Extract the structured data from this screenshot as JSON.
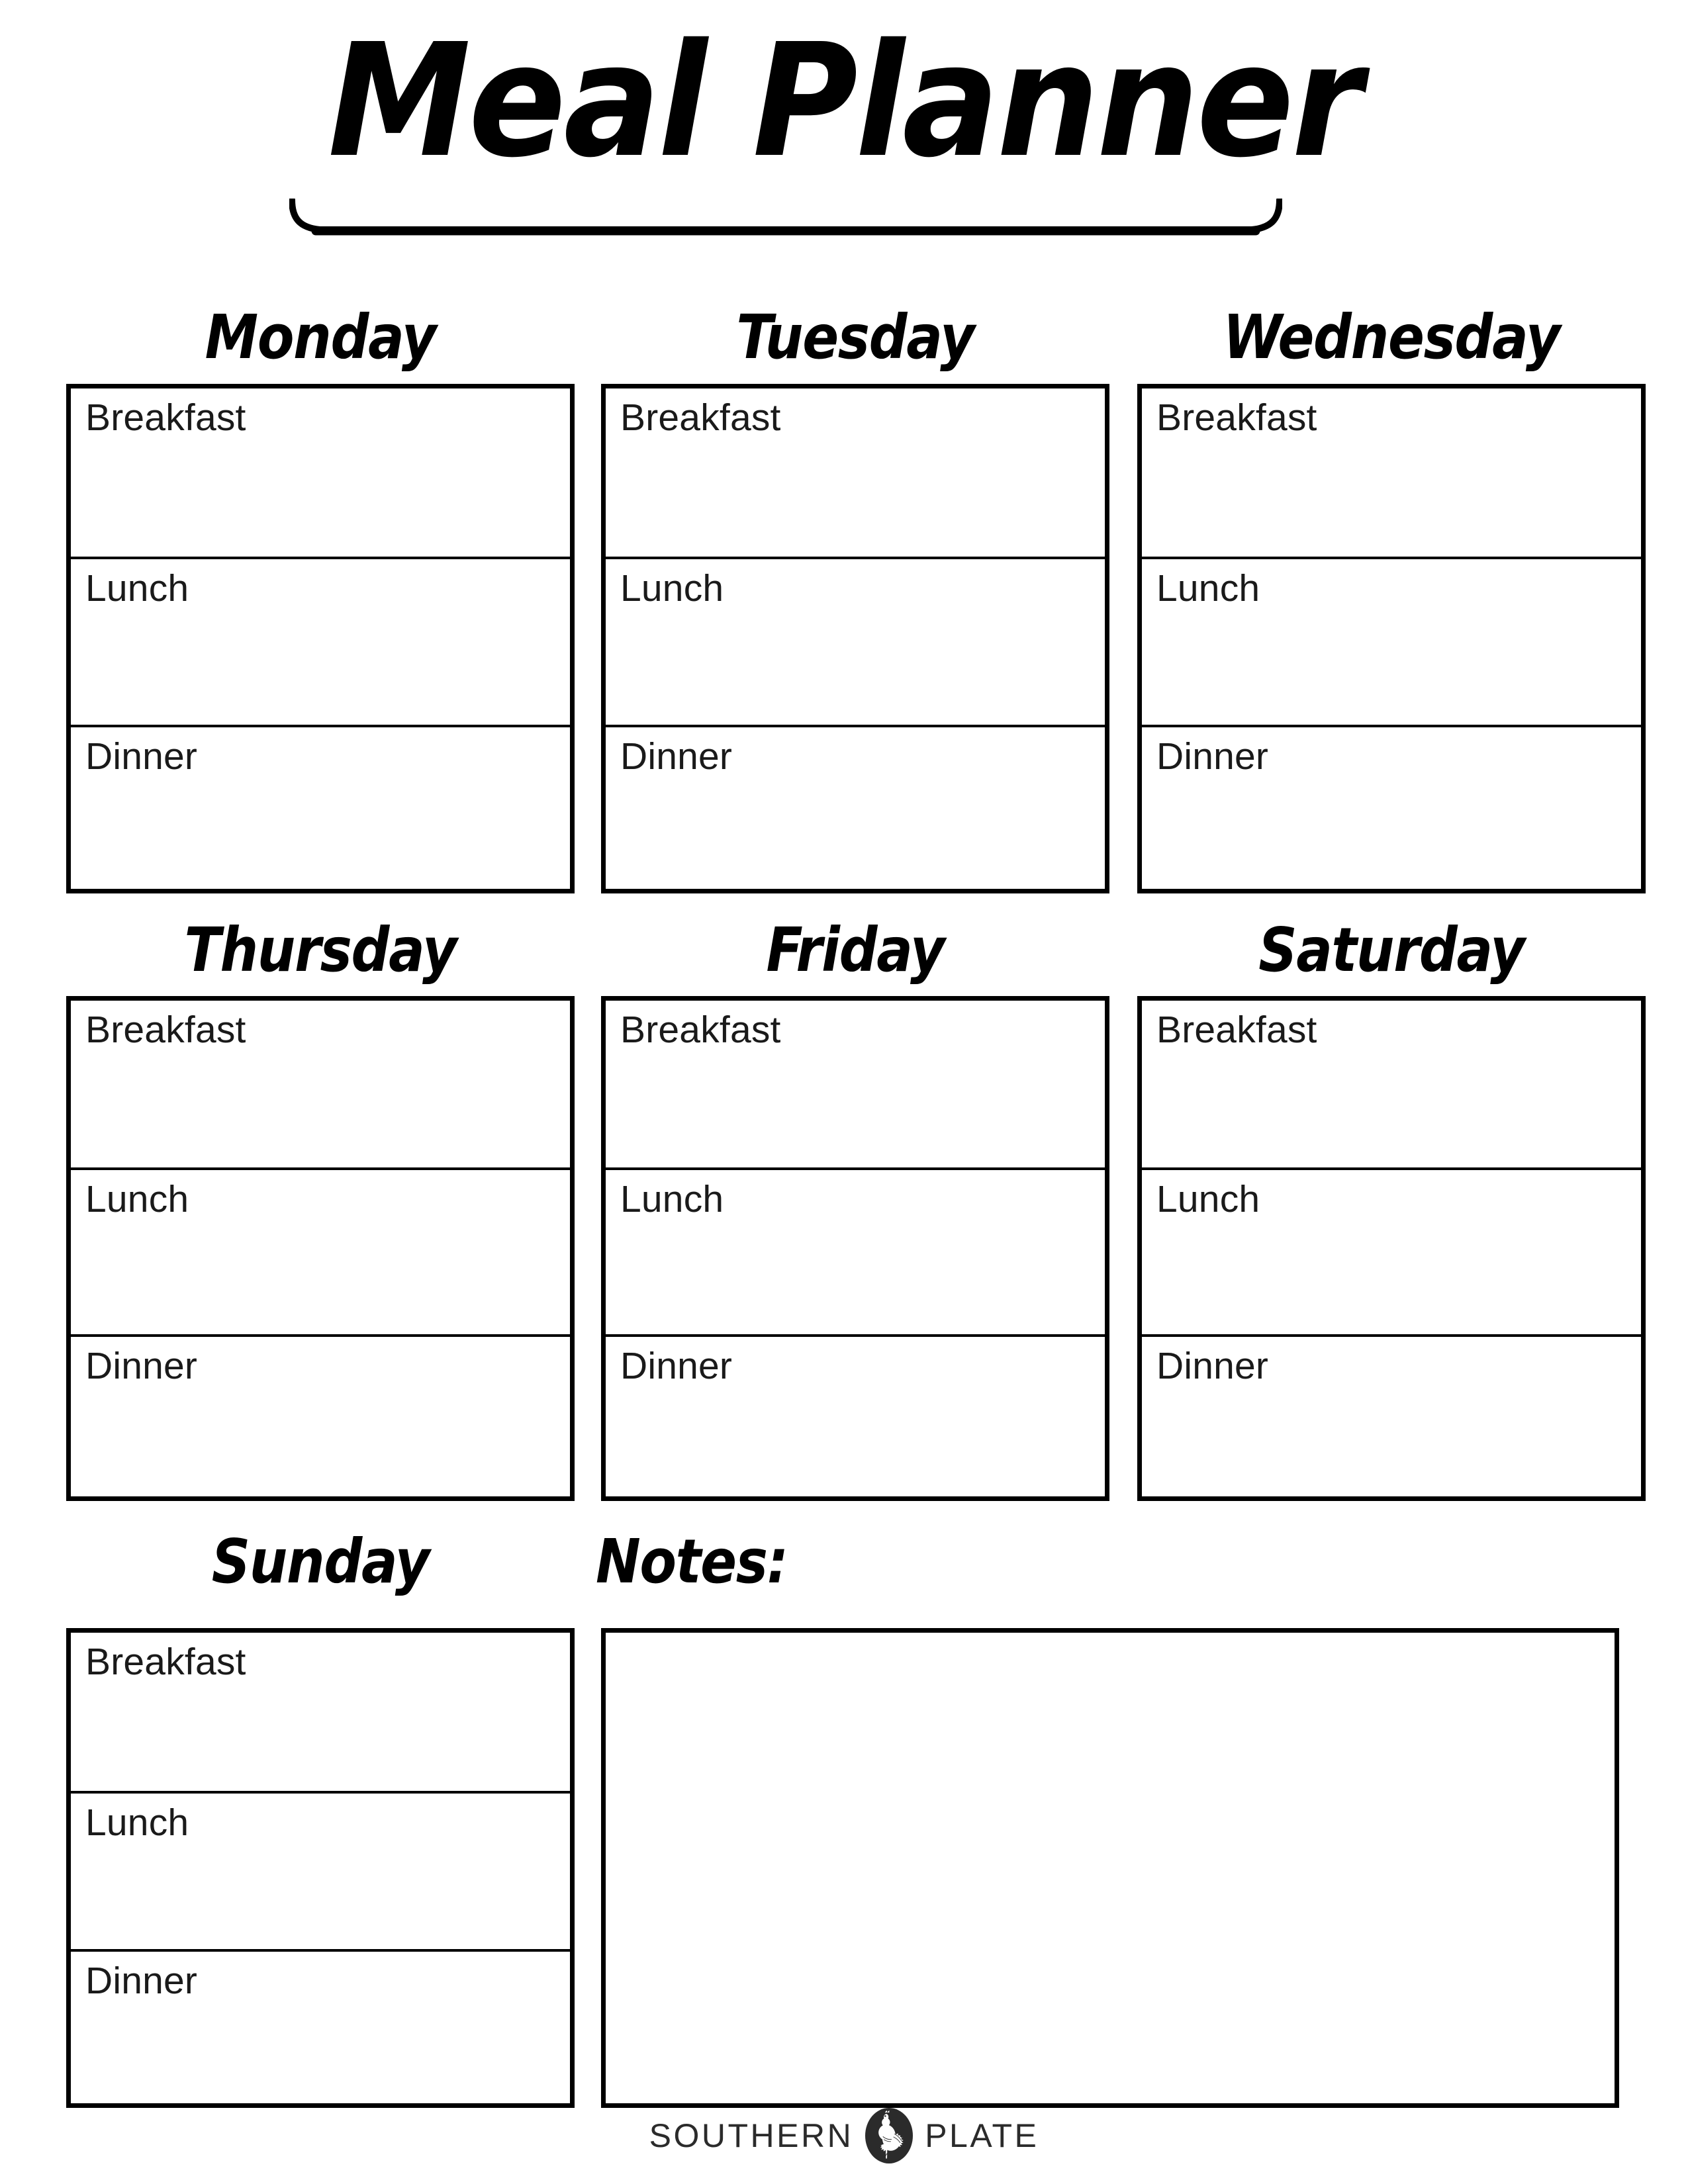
{
  "document": {
    "title": "Meal Planner",
    "background_color": "#ffffff",
    "ink_color": "#000000"
  },
  "meal_labels": {
    "breakfast": "Breakfast",
    "lunch": "Lunch",
    "dinner": "Dinner"
  },
  "days": [
    {
      "name": "Monday",
      "meals": [
        {
          "label": "Breakfast",
          "value": ""
        },
        {
          "label": "Lunch",
          "value": ""
        },
        {
          "label": "Dinner",
          "value": ""
        }
      ]
    },
    {
      "name": "Tuesday",
      "meals": [
        {
          "label": "Breakfast",
          "value": ""
        },
        {
          "label": "Lunch",
          "value": ""
        },
        {
          "label": "Dinner",
          "value": ""
        }
      ]
    },
    {
      "name": "Wednesday",
      "meals": [
        {
          "label": "Breakfast",
          "value": ""
        },
        {
          "label": "Lunch",
          "value": ""
        },
        {
          "label": "Dinner",
          "value": ""
        }
      ]
    },
    {
      "name": "Thursday",
      "meals": [
        {
          "label": "Breakfast",
          "value": ""
        },
        {
          "label": "Lunch",
          "value": ""
        },
        {
          "label": "Dinner",
          "value": ""
        }
      ]
    },
    {
      "name": "Friday",
      "meals": [
        {
          "label": "Breakfast",
          "value": ""
        },
        {
          "label": "Lunch",
          "value": ""
        },
        {
          "label": "Dinner",
          "value": ""
        }
      ]
    },
    {
      "name": "Saturday",
      "meals": [
        {
          "label": "Breakfast",
          "value": ""
        },
        {
          "label": "Lunch",
          "value": ""
        },
        {
          "label": "Dinner",
          "value": ""
        }
      ]
    },
    {
      "name": "Sunday",
      "meals": [
        {
          "label": "Breakfast",
          "value": ""
        },
        {
          "label": "Lunch",
          "value": ""
        },
        {
          "label": "Dinner",
          "value": ""
        }
      ]
    }
  ],
  "notes": {
    "heading": "Notes:",
    "value": ""
  },
  "footer": {
    "word_left": "SOUTHERN",
    "word_right": "PLATE",
    "logo_icon": "rooster-icon"
  }
}
